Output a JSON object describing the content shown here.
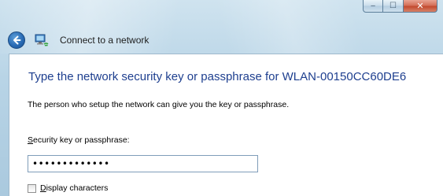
{
  "window": {
    "title": "Connect to a network",
    "caption_buttons": {
      "minimize_glyph": "‒",
      "maximize_glyph": "☐",
      "close_glyph": "✕"
    }
  },
  "nav": {
    "back_icon": "back-arrow-icon",
    "network_icon": "network-icon"
  },
  "main": {
    "heading": "Type the network security key or passphrase for WLAN-00150CC60DE6",
    "description": "The person who setup the network can give you the key or passphrase.",
    "key_label_access": "S",
    "key_label_rest": "ecurity key or passphrase:",
    "key_value": "•••••••••••••",
    "display_access": "D",
    "display_rest": "isplay characters"
  },
  "colors": {
    "heading": "#1e3f8f",
    "close_button": "#c24b2f",
    "frame": "#b8d4e6"
  }
}
